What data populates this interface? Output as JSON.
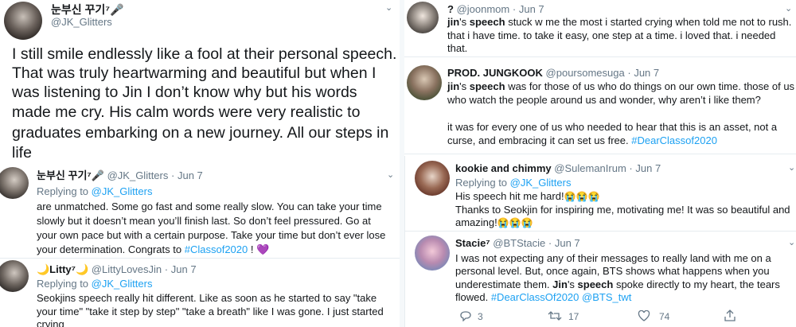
{
  "left": {
    "main_tweet": {
      "name": "눈부신 꾸기⁷🎤",
      "handle": "@JK_Glitters",
      "text_lines": [
        "I still smile endlessly like a fool at their personal speech.",
        "That was truly heartwarming and beautiful but when I",
        "was listening to Jin I don’t know why but his words",
        "made me cry. His calm words were very realistic to",
        "graduates embarking on a new journey. All our steps in",
        "life"
      ]
    },
    "reply1": {
      "name": "눈부신 꾸기⁷🎤",
      "handle": "@JK_Glitters",
      "dot": "·",
      "date": "Jun 7",
      "replying_prefix": "Replying to",
      "replying_handle": "@JK_Glitters",
      "lines": [
        "are unmatched. Some go fast and some really slow. You can take your time",
        "slowly but it doesn’t mean you’ll finish last. So don’t feel pressured. Go at",
        "your own pace but with a certain purpose. Take your time but don’t ever lose",
        "your determination. Congrats to"
      ],
      "hashtag": "#Classof2020",
      "tail": "!",
      "heart": "💜"
    },
    "reply2": {
      "name": "🌙Litty⁷🌙",
      "handle": "@LittyLovesJin",
      "dot": "·",
      "date": "Jun 7",
      "replying_prefix": "Replying to",
      "replying_handle": "@JK_Glitters",
      "lines": [
        "Seokjins speech really hit different. Like as soon as he started to say \"take",
        "your time\" \"take it step by step\" \"take a breath\" like I was gone. I just started",
        "crying"
      ]
    }
  },
  "right": {
    "t1": {
      "name": "?",
      "handle": "@joonmom",
      "dot": "·",
      "date": "Jun 7",
      "kw1": "jin",
      "kw2": "speech",
      "line1_rest": " stuck w me the most i started crying when told me not to rush.",
      "line2": "that i have time. to take it easy, one step at a time. i loved that. i needed",
      "line3": "that."
    },
    "t2": {
      "name": "PROD. JUNGKOOK",
      "handle": "@poursomesuga",
      "dot": "·",
      "date": "Jun 7",
      "kw1": "jin",
      "kw2": "speech",
      "line1_rest": " was for those of us who do things on our own time. those of us",
      "line2": "who watch the people around us and wonder, why aren’t i like them?",
      "line3": "it was for every one of us who needed to hear that this is an asset, not a",
      "line4": "curse, and embracing it can set us free.",
      "hashtag": "#DearClassof2020"
    },
    "t3": {
      "name": "kookie and chimmy",
      "handle": "@SulemanIrum",
      "dot": "·",
      "date": "Jun 7",
      "replying_prefix": "Replying to",
      "replying_handle": "@JK_Glitters",
      "line1": "His speech hit me hard!",
      "line1_emoji": "😭😭😭",
      "line2": "Thanks to Seokjin for inspiring me,  motivating me! It was so beautiful and",
      "line3": "amazing!",
      "line3_emoji": "😭😭😭"
    },
    "t4": {
      "name": "Stacie⁷",
      "handle": "@BTStacie",
      "dot": "·",
      "date": "Jun 7",
      "line1": "I was not expecting any of their messages to really land with me on a",
      "line2": "personal level.  But, once again, BTS shows what happens when you",
      "line3": "underestimate them.",
      "kw1": "Jin",
      "kw2": "speech",
      "line3_rest": " spoke directly to my heart, the tears",
      "line4": "flowed.",
      "hashtag": "#DearClassOf2020",
      "mention": "@BTS_twt",
      "replies": "3",
      "retweets": "17",
      "likes": "74"
    }
  },
  "colors": {
    "link": "#1da1f2",
    "muted": "#657786",
    "text": "#14171a"
  },
  "icons": [
    "chevron-down-icon",
    "reply-icon",
    "retweet-icon",
    "like-icon",
    "share-icon"
  ]
}
